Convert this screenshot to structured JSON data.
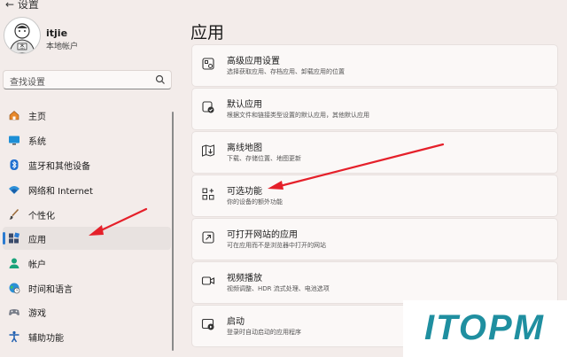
{
  "header": {
    "back": "←",
    "window_title": "设置"
  },
  "user": {
    "name": "itjie",
    "account_type": "本地帐户"
  },
  "search": {
    "placeholder": "查找设置"
  },
  "sidebar": {
    "items": [
      {
        "label": "主页",
        "icon": "home-icon"
      },
      {
        "label": "系统",
        "icon": "monitor-icon"
      },
      {
        "label": "蓝牙和其他设备",
        "icon": "bluetooth-icon"
      },
      {
        "label": "网络和 Internet",
        "icon": "wifi-icon"
      },
      {
        "label": "个性化",
        "icon": "brush-icon"
      },
      {
        "label": "应用",
        "icon": "apps-icon",
        "active": true
      },
      {
        "label": "帐户",
        "icon": "person-icon"
      },
      {
        "label": "时间和语言",
        "icon": "globe-clock-icon"
      },
      {
        "label": "游戏",
        "icon": "gamepad-icon"
      },
      {
        "label": "辅助功能",
        "icon": "accessibility-icon"
      }
    ]
  },
  "main": {
    "title": "应用",
    "cards": [
      {
        "title": "高级应用设置",
        "subtitle": "选择获取应用、存档应用、卸载应用的位置",
        "icon": "advanced-apps-icon"
      },
      {
        "title": "默认应用",
        "subtitle": "根据文件和链接类型设置的默认应用，其他默认应用",
        "icon": "default-apps-icon"
      },
      {
        "title": "离线地图",
        "subtitle": "下载、存储位置、地图更新",
        "icon": "offline-map-icon"
      },
      {
        "title": "可选功能",
        "subtitle": "你的设备的额外功能",
        "icon": "optional-features-icon"
      },
      {
        "title": "可打开网站的应用",
        "subtitle": "可在应用而不是浏览器中打开的网站",
        "icon": "open-web-app-icon"
      },
      {
        "title": "视频播放",
        "subtitle": "视频调整、HDR 流式处理、电池选项",
        "icon": "video-playback-icon"
      },
      {
        "title": "启动",
        "subtitle": "登录时自动启动的应用程序",
        "icon": "startup-icon"
      }
    ]
  },
  "colors": {
    "accent": "#2b7bd1",
    "arrow": "#e5202a",
    "watermark_teal": "#1a9d96",
    "watermark_blue": "#1f5fb0"
  },
  "watermark": {
    "text": "ITOPM"
  }
}
